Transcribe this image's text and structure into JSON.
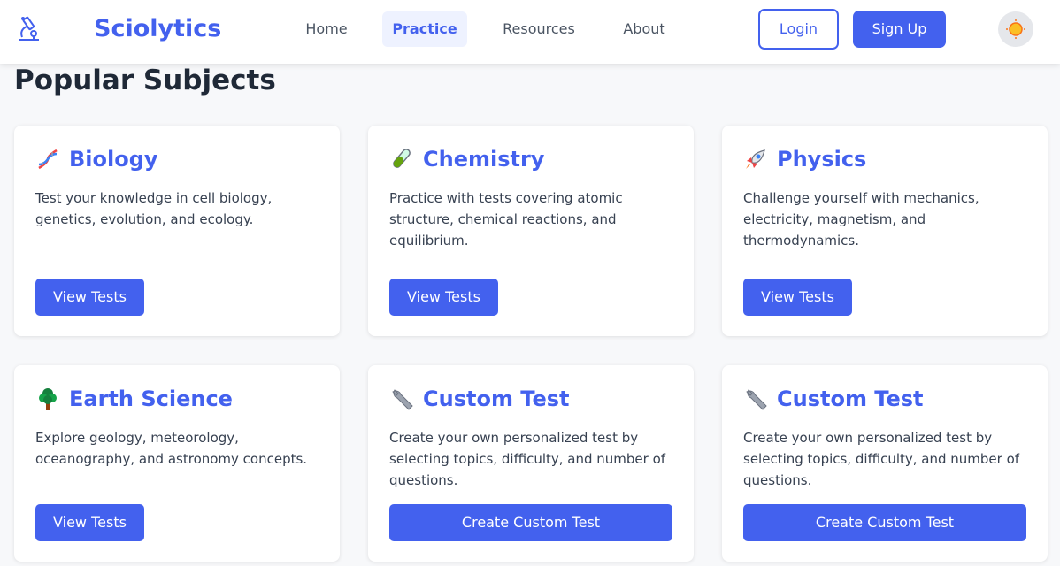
{
  "nav": {
    "brand": "Sciolytics",
    "links": [
      {
        "label": "Home",
        "active": false
      },
      {
        "label": "Practice",
        "active": true
      },
      {
        "label": "Resources",
        "active": false
      },
      {
        "label": "About",
        "active": false
      }
    ],
    "login_label": "Login",
    "signup_label": "Sign Up",
    "logo_icon": "microscope-icon",
    "theme_icon": "sun-icon"
  },
  "main": {
    "section_title": "Popular Subjects",
    "cards": [
      {
        "icon": "dna-icon",
        "title": "Biology",
        "description": "Test your knowledge in cell biology, genetics, evolution, and ecology.",
        "button_label": "View Tests"
      },
      {
        "icon": "test-tube-icon",
        "title": "Chemistry",
        "description": "Practice with tests covering atomic structure, chemical reactions, and equilibrium.",
        "button_label": "View Tests"
      },
      {
        "icon": "rocket-icon",
        "title": "Physics",
        "description": "Challenge yourself with mechanics, electricity, magnetism, and thermodynamics.",
        "button_label": "View Tests"
      },
      {
        "icon": "tree-icon",
        "title": "Earth Science",
        "description": "Explore geology, meteorology, oceanography, and astronomy concepts.",
        "button_label": "View Tests"
      },
      {
        "icon": "wrench-icon",
        "title": "Custom Test",
        "description": "Create your own personalized test by selecting topics, difficulty, and number of questions.",
        "button_label": "Create Custom Test"
      },
      {
        "icon": "wrench-icon",
        "title": "Custom Test",
        "description": "Create your own personalized test by selecting topics, difficulty, and number of questions.",
        "button_label": "Create Custom Test"
      }
    ]
  },
  "colors": {
    "accent": "#4361ee",
    "background": "#f7f8fa",
    "text": "#1f2937"
  }
}
